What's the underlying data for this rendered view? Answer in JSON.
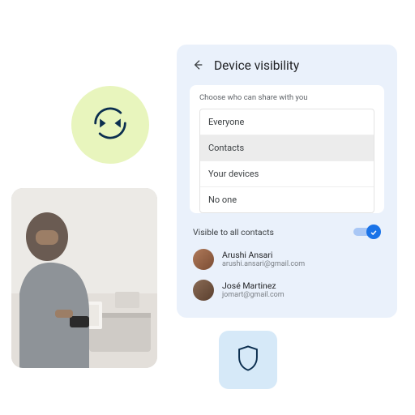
{
  "panel": {
    "title": "Device visibility",
    "prompt": "Choose who can share with you",
    "options": [
      "Everyone",
      "Contacts",
      "Your devices",
      "No one"
    ],
    "selected_index": 1,
    "visible_label": "Visible to all contacts",
    "toggle_on": true,
    "contacts": [
      {
        "name": "Arushi Ansari",
        "email": "arushi.ansari@gmail.com"
      },
      {
        "name": "José Martinez",
        "email": "jomart@gmail.com"
      }
    ]
  },
  "icons": {
    "transfer": "transfer-icon",
    "shield": "shield-icon",
    "back": "back-arrow-icon",
    "check": "check-icon"
  }
}
